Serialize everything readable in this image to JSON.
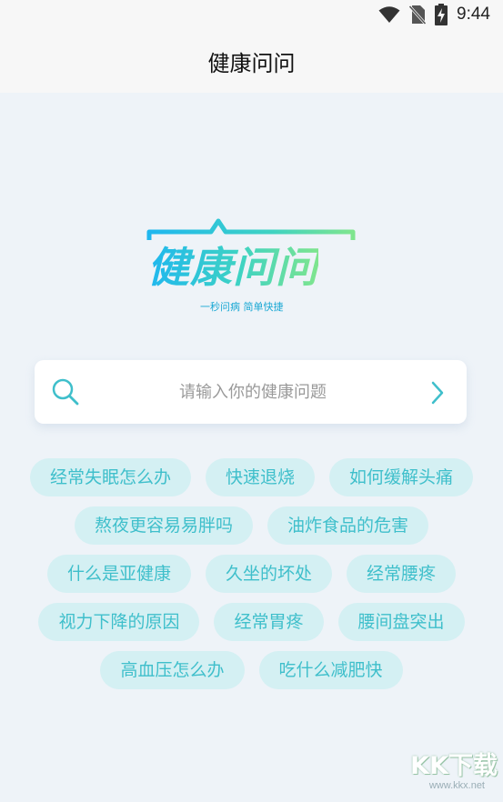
{
  "status_bar": {
    "time": "9:44",
    "icons": [
      "wifi-icon",
      "no-sim-icon",
      "battery-charging-icon"
    ]
  },
  "header": {
    "title": "健康问问"
  },
  "logo": {
    "text": "健康问问",
    "slogan": "一秒问病 简单快捷"
  },
  "search": {
    "placeholder": "请输入你的健康问题",
    "value": "",
    "icon": "search-icon",
    "submit_icon": "chevron-right-icon"
  },
  "tag_rows": [
    [
      "经常失眠怎么办",
      "快速退烧",
      "如何缓解头痛"
    ],
    [
      "熬夜更容易易胖吗",
      "油炸食品的危害"
    ],
    [
      "什么是亚健康",
      "久坐的坏处",
      "经常腰疼"
    ],
    [
      "视力下降的原因",
      "经常胃疼",
      "腰间盘突出"
    ],
    [
      "高血压怎么办",
      "吃什么减肥快"
    ]
  ],
  "watermark": {
    "logo": "KK下载",
    "url": "www.kkx.net"
  },
  "colors": {
    "accent": "#3fbfcb",
    "tag_background": "#d4f0f3",
    "page_background": "#eef3f8",
    "header_background": "#f7f7f7"
  }
}
